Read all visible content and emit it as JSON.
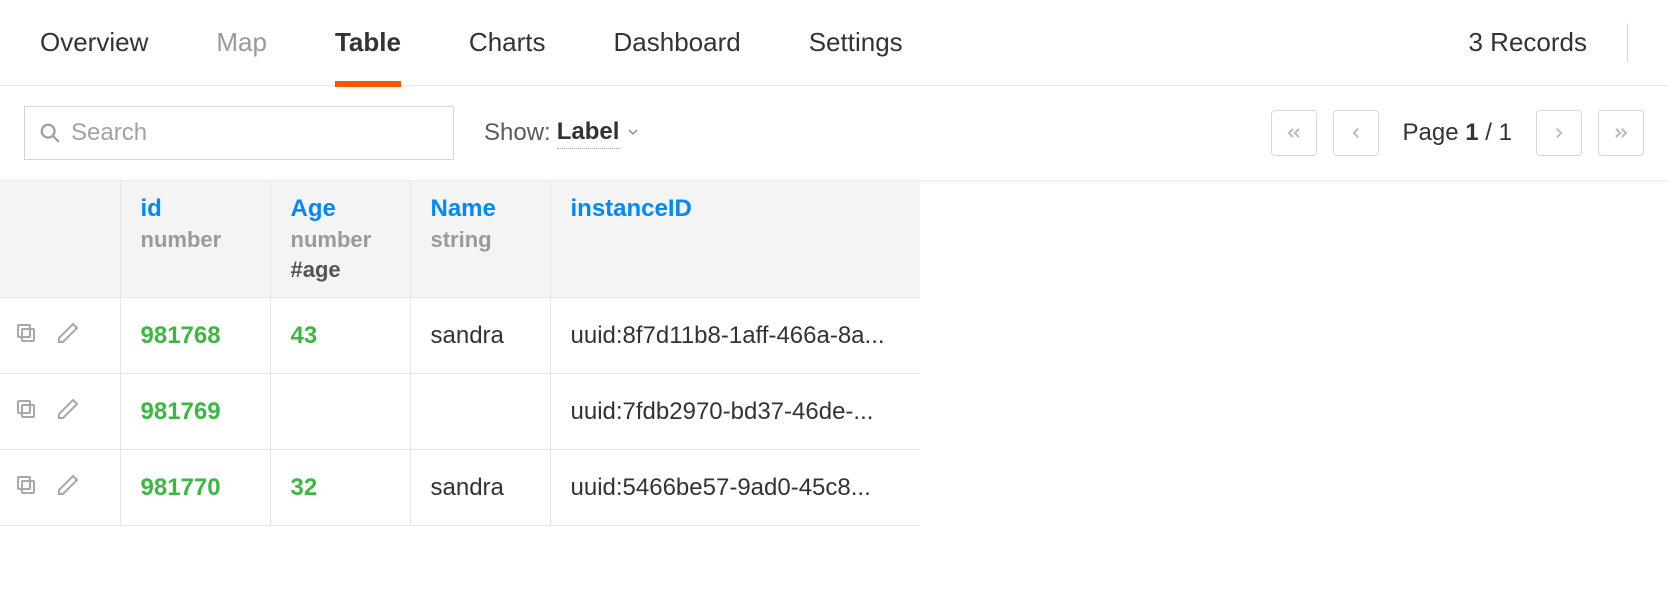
{
  "tabs": [
    {
      "label": "Overview",
      "active": false,
      "dark": true
    },
    {
      "label": "Map",
      "active": false,
      "dark": false
    },
    {
      "label": "Table",
      "active": true,
      "dark": true
    },
    {
      "label": "Charts",
      "active": false,
      "dark": true
    },
    {
      "label": "Dashboard",
      "active": false,
      "dark": true
    },
    {
      "label": "Settings",
      "active": false,
      "dark": true
    }
  ],
  "records_label": "3 Records",
  "search": {
    "placeholder": "Search"
  },
  "show": {
    "prefix": "Show:",
    "value": "Label"
  },
  "pagination": {
    "prefix": "Page",
    "current": "1",
    "sep": "/",
    "total": "1"
  },
  "columns": [
    {
      "name": "id",
      "type": "number",
      "extra": ""
    },
    {
      "name": "Age",
      "type": "number",
      "extra": "#age"
    },
    {
      "name": "Name",
      "type": "string",
      "extra": ""
    },
    {
      "name": "instanceID",
      "type": "",
      "extra": ""
    }
  ],
  "rows": [
    {
      "id": "981768",
      "age": "43",
      "name": "sandra",
      "instanceID": "uuid:8f7d11b8-1aff-466a-8a..."
    },
    {
      "id": "981769",
      "age": "",
      "name": "",
      "instanceID": "uuid:7fdb2970-bd37-46de-..."
    },
    {
      "id": "981770",
      "age": "32",
      "name": "sandra",
      "instanceID": "uuid:5466be57-9ad0-45c8..."
    }
  ]
}
